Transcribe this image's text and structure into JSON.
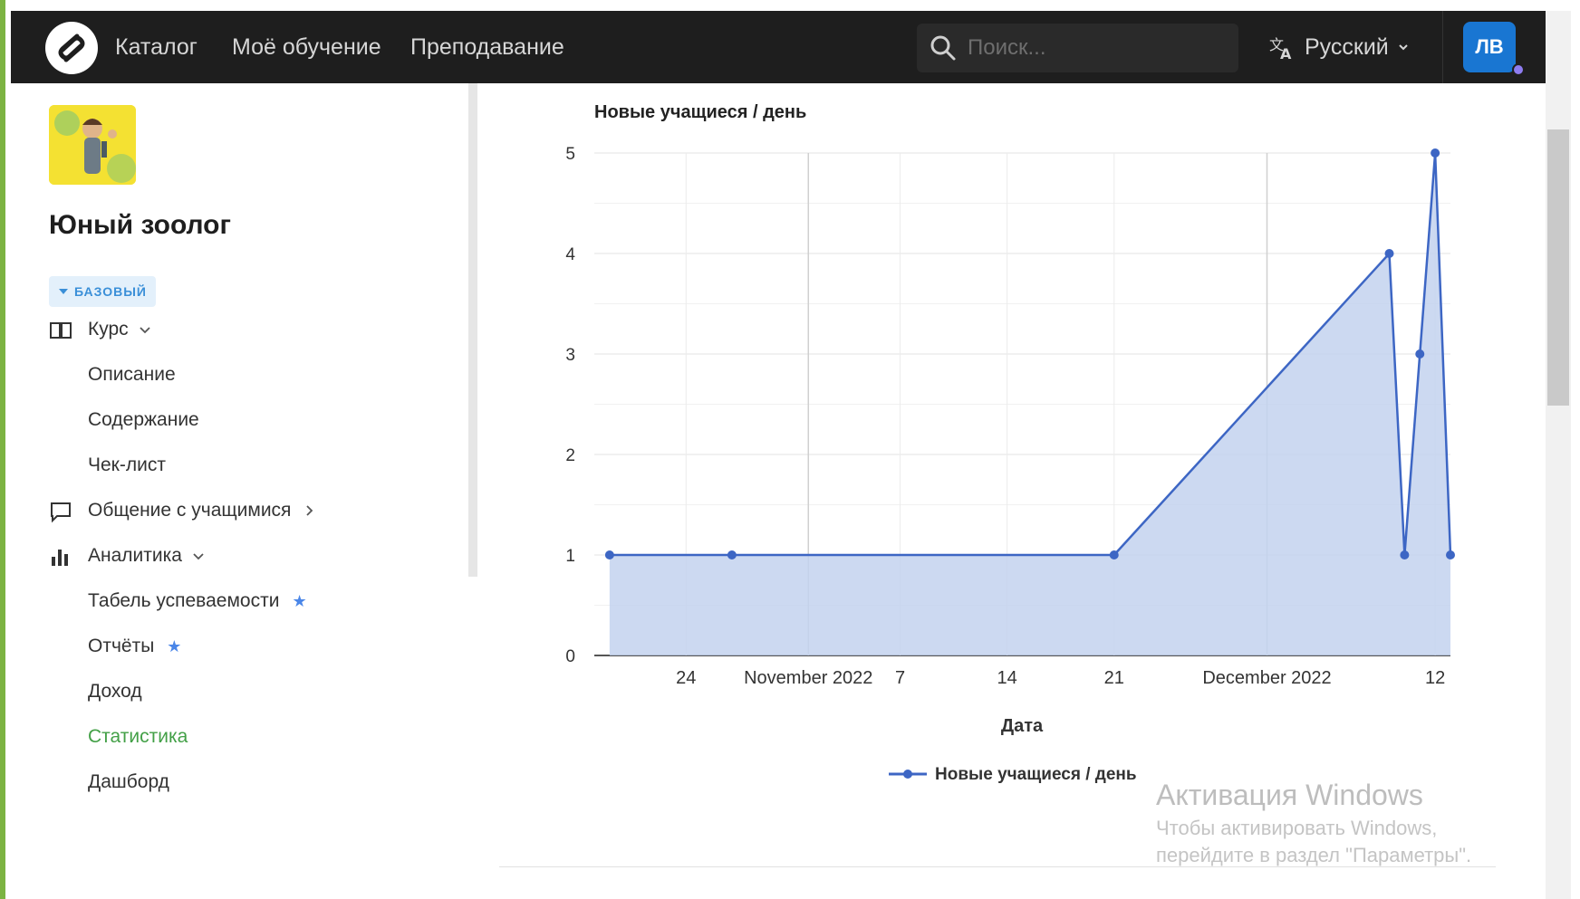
{
  "nav": {
    "links": [
      "Каталог",
      "Моё обучение",
      "Преподавание"
    ],
    "search_placeholder": "Поиск...",
    "language": "Русский",
    "avatar_initials": "ЛВ"
  },
  "sidebar": {
    "course_title": "Юный зоолог",
    "badge": "БАЗОВЫЙ",
    "course_label": "Курс",
    "course_items": [
      "Описание",
      "Содержание",
      "Чек-лист"
    ],
    "communication_label": "Общение с учащимися",
    "analytics_label": "Аналитика",
    "analytics_items": [
      "Табель успеваемости",
      "Отчёты",
      "Доход",
      "Статистика",
      "Дашборд"
    ],
    "active_item": "Статистика"
  },
  "chart_data": {
    "type": "area",
    "title": "Новые учащиеся / день",
    "xlabel": "Дата",
    "ylabel": "",
    "ylim": [
      0,
      5
    ],
    "yticks": [
      0,
      1,
      2,
      3,
      4,
      5
    ],
    "xlim": [
      "2022-10-18",
      "2022-12-13"
    ],
    "xticks": [
      {
        "date": "2022-10-24",
        "label": "24"
      },
      {
        "date": "2022-11-01",
        "label": "November 2022"
      },
      {
        "date": "2022-11-07",
        "label": "7"
      },
      {
        "date": "2022-11-14",
        "label": "14"
      },
      {
        "date": "2022-11-21",
        "label": "21"
      },
      {
        "date": "2022-12-01",
        "label": "December 2022"
      },
      {
        "date": "2022-12-12",
        "label": "12"
      }
    ],
    "grid": true,
    "legend": "bottom",
    "series": [
      {
        "name": "Новые учащиеся / день",
        "color": "#3d66c4",
        "fill": "#c3d2ee",
        "points": [
          {
            "x": "2022-10-19",
            "y": 1
          },
          {
            "x": "2022-10-27",
            "y": 1
          },
          {
            "x": "2022-11-21",
            "y": 1
          },
          {
            "x": "2022-12-09",
            "y": 4
          },
          {
            "x": "2022-12-10",
            "y": 1
          },
          {
            "x": "2022-12-11",
            "y": 3
          },
          {
            "x": "2022-12-12",
            "y": 5
          },
          {
            "x": "2022-12-13",
            "y": 1
          }
        ]
      }
    ]
  },
  "watermark": {
    "title": "Активация Windows",
    "line1": "Чтобы активировать Windows,",
    "line2": "перейдите в раздел \"Параметры\"."
  },
  "colors": {
    "nav_bg": "#1e1e1e",
    "accent_blue": "#1976d2",
    "active_green": "#43a047"
  }
}
